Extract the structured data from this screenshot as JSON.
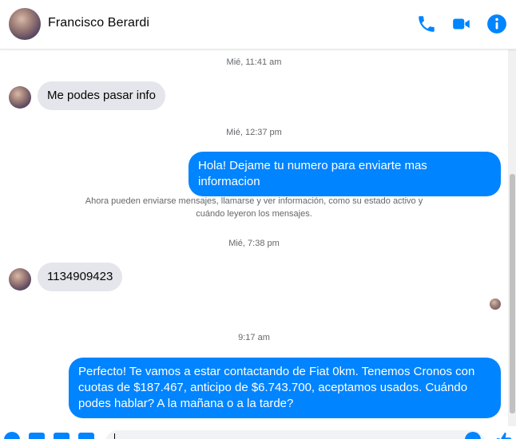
{
  "header": {
    "contact_name": "Francisco Berardi",
    "icons": [
      "phone-icon",
      "video-camera-icon",
      "info-icon"
    ],
    "accent_color": "#0084ff"
  },
  "thread": {
    "timestamps": {
      "t1": "Mié, 11:41 am",
      "t2": "Mié, 12:37 pm",
      "t3": "Mié, 7:38 pm",
      "t4": "9:17 am"
    },
    "messages": {
      "m1": "Me podes pasar info",
      "m2": "Hola! Dejame tu numero para enviarte mas informacion",
      "m3": "1134909423",
      "m4": "Perfecto! Te vamos a estar contactando de Fiat 0km. Tenemos Cronos con cuotas de $187.467, anticipo de $6.743.700, aceptamos usados. Cuándo podes hablar? A la mañana o a la tarde?"
    },
    "notice": "Ahora pueden enviarse mensajes, llamarse y ver información, como su estado activo y cuándo leyeron los mensajes.",
    "incoming_color": "#e4e6eb",
    "outgoing_color": "#0084ff"
  },
  "composer": {
    "icons": [
      "plus-circle-icon",
      "photo-icon",
      "sticker-icon",
      "gif-icon",
      "emoji-icon",
      "thumbs-up-icon"
    ]
  }
}
